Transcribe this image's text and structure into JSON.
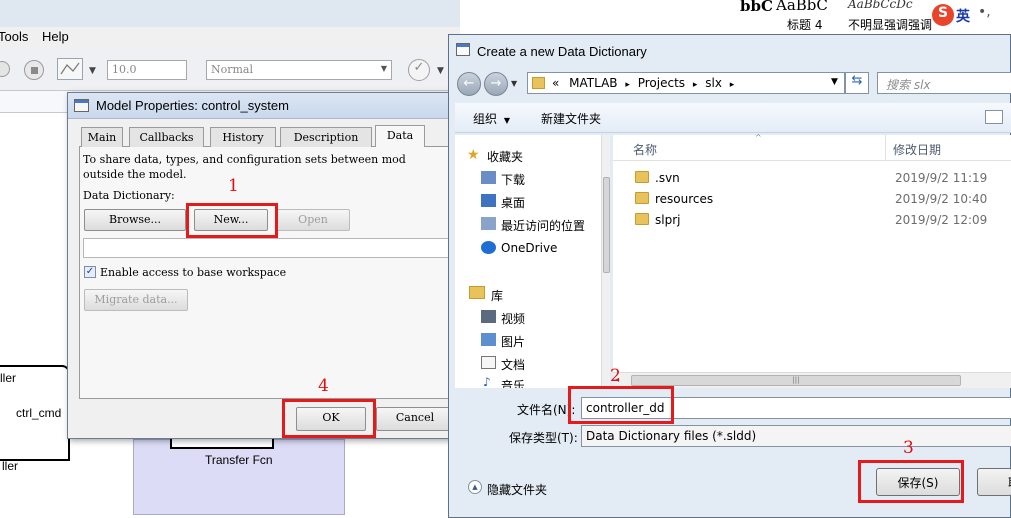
{
  "simulink": {
    "menu": {
      "tools": "Tools",
      "help": "Help"
    },
    "toolbar": {
      "stop_time": "10.0",
      "sim_mode": "Normal"
    },
    "blocks": {
      "controller_partial": "ller",
      "ctrl_cmd": "ctrl_cmd",
      "lower_partial": "ller",
      "transfer_fcn": "Transfer Fcn"
    }
  },
  "word_ribbon": {
    "styles": [
      "bbC",
      "AaBbC",
      "AaBbCcDc",
      "AaBbCcD"
    ],
    "heading": "标题 4",
    "subtle": "不明显强调",
    "more": "强调",
    "ime": "英"
  },
  "model_props": {
    "title": "Model Properties: control_system",
    "tabs": [
      "Main",
      "Callbacks",
      "History",
      "Description",
      "Data"
    ],
    "active_tab": "Data",
    "description": "To share data, types, and configuration sets between mod",
    "description2": "outside the model.",
    "dict_label": "Data Dictionary:",
    "browse": "Browse...",
    "new": "New...",
    "open": "Open",
    "enable_access": "Enable access to base workspace",
    "migrate": "Migrate data...",
    "ok": "OK",
    "cancel": "Cancel"
  },
  "save_dialog": {
    "title": "Create a new Data Dictionary",
    "breadcrumb": [
      "«",
      "MATLAB",
      "Projects",
      "slx"
    ],
    "search_placeholder": "搜索 slx",
    "organize": "组织",
    "new_folder": "新建文件夹",
    "nav": {
      "favorites": "收藏夹",
      "downloads": "下载",
      "desktop": "桌面",
      "recent": "最近访问的位置",
      "onedrive": "OneDrive",
      "libraries": "库",
      "videos": "视频",
      "pictures": "图片",
      "documents": "文档",
      "music": "音乐"
    },
    "columns": {
      "name": "名称",
      "modified": "修改日期"
    },
    "files": [
      {
        "name": ".svn",
        "date": "2019/9/2 11:19"
      },
      {
        "name": "resources",
        "date": "2019/9/2 10:40"
      },
      {
        "name": "slprj",
        "date": "2019/9/2 12:09"
      }
    ],
    "filename_label": "文件名(N):",
    "filename_value": "controller_dd",
    "filetype_label": "保存类型(T):",
    "filetype_value": "Data Dictionary files (*.sldd)",
    "hide_folders": "隐藏文件夹",
    "save": "保存(S)",
    "cancel_partial": "取"
  },
  "annotations": [
    "1",
    "2",
    "3",
    "4"
  ],
  "colors": {
    "annotation_red": "#e51a1a",
    "dialog_bg": "#f0f0f0",
    "win7_frame": "#e3ebf5"
  }
}
